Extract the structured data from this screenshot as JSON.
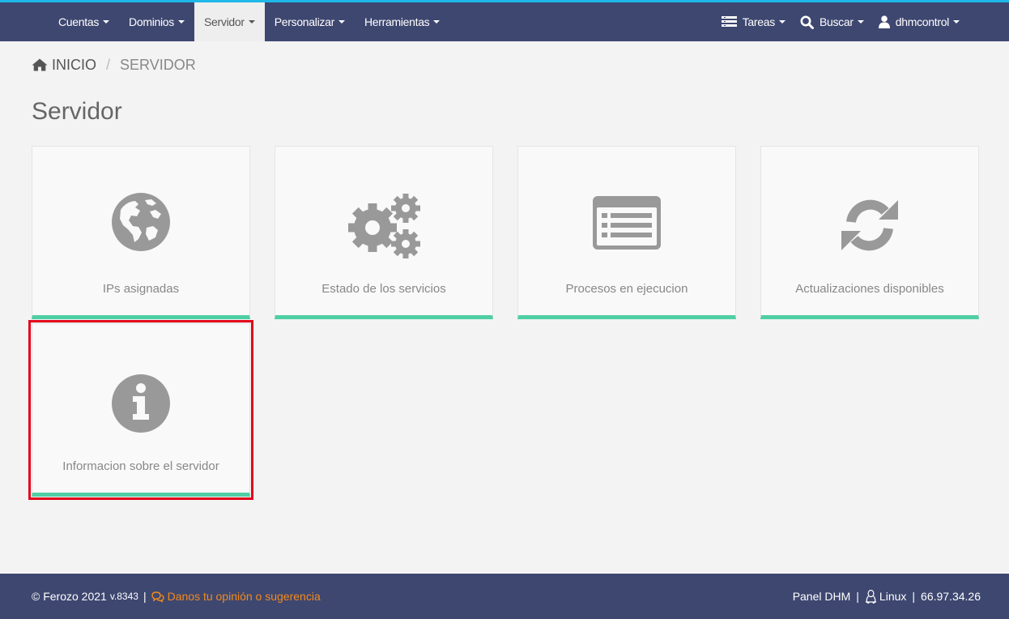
{
  "navbar": {
    "left": [
      {
        "label": "Cuentas"
      },
      {
        "label": "Dominios"
      },
      {
        "label": "Servidor",
        "active": true
      },
      {
        "label": "Personalizar"
      },
      {
        "label": "Herramientas"
      }
    ],
    "right": {
      "tasks": "Tareas",
      "search": "Buscar",
      "user": "dhmcontrol"
    }
  },
  "breadcrumb": {
    "home": "INICIO",
    "separator": "/",
    "current": "SERVIDOR"
  },
  "page": {
    "title": "Servidor"
  },
  "tiles": [
    {
      "label": "IPs asignadas",
      "icon": "globe-icon"
    },
    {
      "label": "Estado de los servicios",
      "icon": "gears-icon"
    },
    {
      "label": "Procesos en ejecucion",
      "icon": "list-window-icon"
    },
    {
      "label": "Actualizaciones disponibles",
      "icon": "refresh-icon"
    },
    {
      "label": "Informacion sobre el servidor",
      "icon": "info-icon",
      "highlighted": true
    }
  ],
  "footer": {
    "copyright": "© Ferozo 2021",
    "version": "v.8343",
    "separator": "|",
    "feedback": "Danos tu opinión o sugerencia",
    "panel": "Panel DHM",
    "os": "Linux",
    "ip": "66.97.34.26"
  },
  "colors": {
    "navbar": "#3e4770",
    "accent_line": "#1fb8e8",
    "tile_border": "#4fcfa3",
    "highlight": "#e1061a",
    "link": "#f28a1c",
    "icon": "#999999"
  }
}
